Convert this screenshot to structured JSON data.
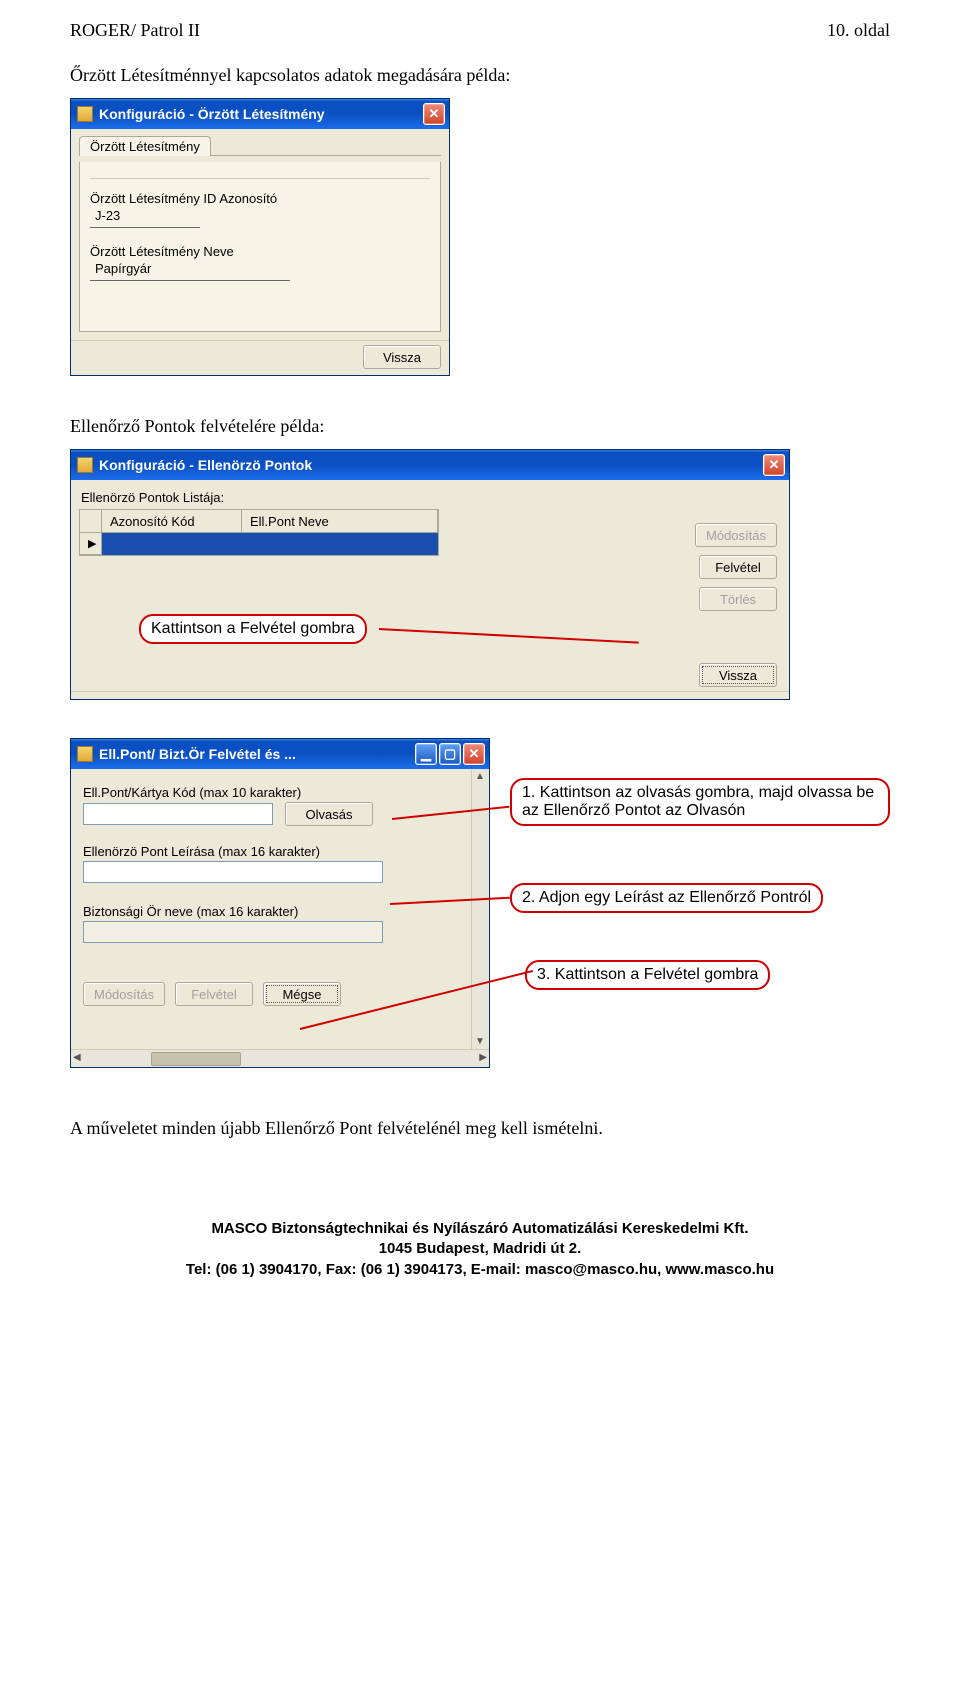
{
  "header": {
    "left": "ROGER/ Patrol II",
    "right": "10. oldal"
  },
  "section1": {
    "intro": "Őrzött Létesítménnyel kapcsolatos adatok megadására példa:",
    "win_title": "Konfiguráció - Örzött Létesítmény",
    "tab": "Örzött Létesítmény",
    "id_label": "Örzött Létesítmény ID Azonosító",
    "id_value": "J-23",
    "name_label": "Örzött Létesítmény Neve",
    "name_value": "Papírgyár",
    "back": "Vissza"
  },
  "section2": {
    "intro": "Ellenőrző Pontok felvételére példa:",
    "win_title": "Konfiguráció - Ellenörzö Pontok",
    "list_label": "Ellenörzö Pontok Listája:",
    "col1": "Azonosító Kód",
    "col2": "Ell.Pont Neve",
    "btn_mod": "Módosítás",
    "btn_add": "Felvétel",
    "btn_del": "Törlés",
    "btn_back": "Vissza",
    "callout": "Kattintson a Felvétel gombra"
  },
  "section3": {
    "win_title": "Ell.Pont/ Bizt.Ör Felvétel és ...",
    "f1_label": "Ell.Pont/Kártya Kód (max 10 karakter)",
    "btn_read": "Olvasás",
    "f2_label": "Ellenörzö Pont Leírása (max 16 karakter)",
    "f3_label": "Biztonsági Ör neve (max 16 karakter)",
    "btn_mod": "Módosítás",
    "btn_add": "Felvétel",
    "btn_cancel": "Mégse",
    "call1": "1. Kattintson az olvasás gombra, majd olvassa be az Ellenőrző Pontot az Olvasón",
    "call2": "2. Adjon egy Leírást az Ellenőrző Pontról",
    "call3": "3. Kattintson a Felvétel gombra"
  },
  "closing": "A műveletet minden újabb Ellenőrző Pont felvételénél meg kell ismételni.",
  "footer": {
    "l1": "MASCO Biztonságtechnikai és Nyílászáró Automatizálási Kereskedelmi Kft.",
    "l2": "1045 Budapest, Madridi út 2.",
    "l3": "Tel: (06 1) 3904170, Fax: (06 1) 3904173, E-mail: masco@masco.hu, www.masco.hu"
  }
}
